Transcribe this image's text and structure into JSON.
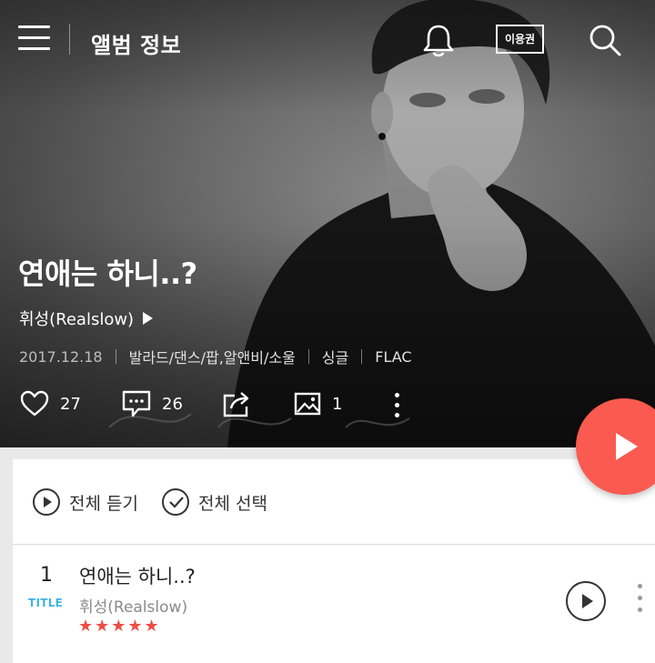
{
  "header": {
    "title": "앨범 정보",
    "pass_label": "이용권",
    "icons": [
      "menu-icon",
      "bell-icon",
      "search-icon"
    ]
  },
  "album": {
    "title": "연애는 하니..?",
    "artist": "휘성(Realslow)",
    "release_date": "2017.12.18",
    "genre": "발라드/댄스/팝,알앤비/소울",
    "type": "싱글",
    "format": "FLAC",
    "like_count": "27",
    "comment_count": "26",
    "image_count": "1"
  },
  "controls": {
    "play_all": "전체 듣기",
    "select_all": "전체 선택"
  },
  "tracks": [
    {
      "number": "1",
      "badge": "TITLE",
      "name": "연애는 하니..?",
      "artist": "휘성(Realslow)",
      "rating": "★★★★★"
    }
  ],
  "colors": {
    "accent": "#fa5a4f",
    "title_badge": "#3db3e5",
    "rating": "#ef4c46"
  }
}
